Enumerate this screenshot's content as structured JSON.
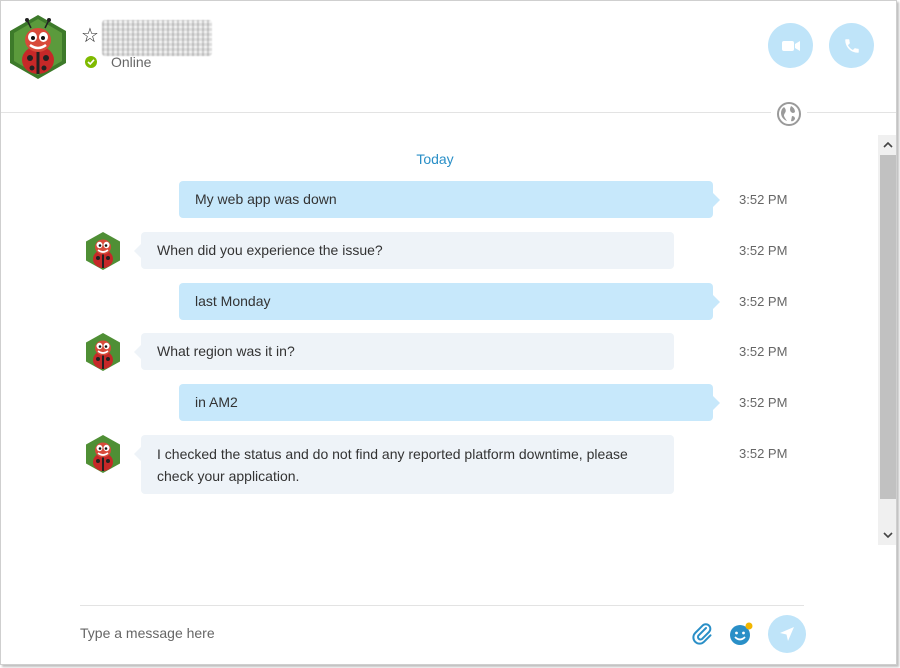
{
  "contact": {
    "presence": "Online",
    "avatar_icon": "ladybug-avatar-icon"
  },
  "header": {
    "video_call_icon": "video-camera-icon",
    "audio_call_icon": "phone-icon",
    "globe_icon": "globe-icon",
    "favorite_icon": "star-outline-icon"
  },
  "chat": {
    "date_label": "Today",
    "messages": [
      {
        "direction": "out",
        "text": "My web app was down",
        "time": "3:52 PM"
      },
      {
        "direction": "in",
        "text": "When did you experience the issue?",
        "time": "3:52 PM"
      },
      {
        "direction": "out",
        "text": "last Monday",
        "time": "3:52 PM"
      },
      {
        "direction": "in",
        "text": "What region was it in?",
        "time": "3:52 PM"
      },
      {
        "direction": "out",
        "text": "in AM2",
        "time": "3:52 PM"
      },
      {
        "direction": "in",
        "text": "I checked the status and do not find any reported platform downtime, please check your application.",
        "time": "3:52 PM"
      }
    ]
  },
  "compose": {
    "placeholder": "Type a message here",
    "attach_icon": "paperclip-icon",
    "emoji_icon": "smiley-icon",
    "send_icon": "send-arrow-icon"
  },
  "colors": {
    "accent": "#2a8fc7",
    "outgoing_bubble": "#c7e8fb",
    "incoming_bubble": "#eef3f8",
    "presence_online": "#7fba00",
    "call_button": "#bfe4f9"
  }
}
